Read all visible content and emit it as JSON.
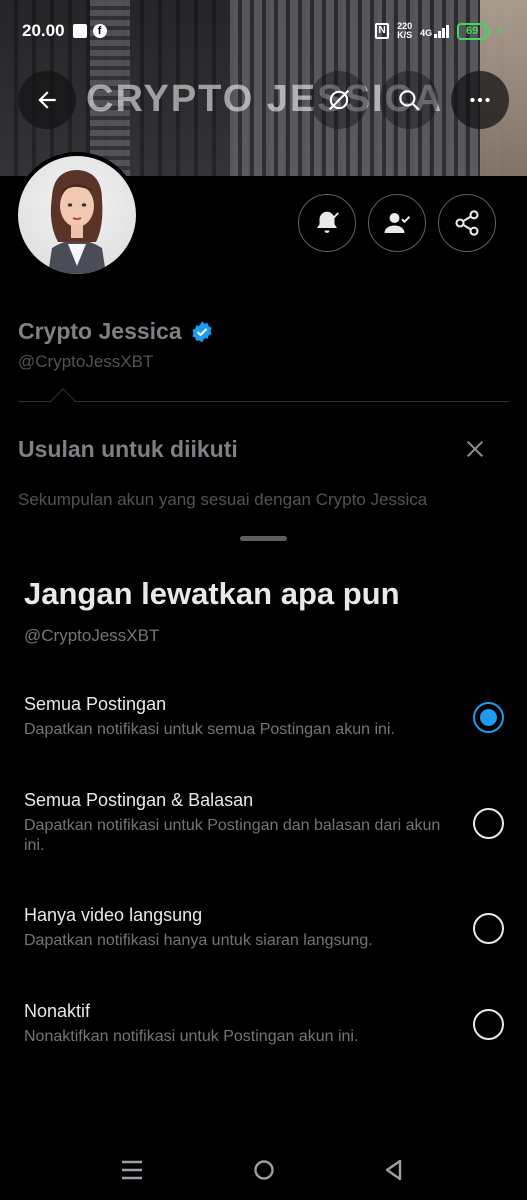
{
  "status_bar": {
    "time": "20.00",
    "speed_top": "220",
    "speed_bottom": "K/S",
    "network": "4G",
    "battery": "69"
  },
  "header": {
    "title": "CRYPTO JESSICA"
  },
  "profile": {
    "name": "Crypto Jessica",
    "handle": "@CryptoJessXBT",
    "verified_color": "#1d9bf0"
  },
  "suggestions": {
    "title": "Usulan untuk diikuti",
    "subtitle": "Sekumpulan akun yang sesuai dengan Crypto Jessica"
  },
  "sheet": {
    "title": "Jangan lewatkan apa pun",
    "handle": "@CryptoJessXBT",
    "options": [
      {
        "label": "Semua Postingan",
        "desc": "Dapatkan notifikasi untuk semua Postingan akun ini.",
        "selected": true
      },
      {
        "label": "Semua Postingan & Balasan",
        "desc": "Dapatkan notifikasi untuk Postingan dan balasan dari akun ini.",
        "selected": false
      },
      {
        "label": "Hanya video langsung",
        "desc": "Dapatkan notifikasi hanya untuk siaran langsung.",
        "selected": false
      },
      {
        "label": "Nonaktif",
        "desc": "Nonaktifkan notifikasi untuk Postingan akun ini.",
        "selected": false
      }
    ]
  },
  "colors": {
    "accent": "#1d9bf0",
    "battery": "#3ddc58"
  }
}
